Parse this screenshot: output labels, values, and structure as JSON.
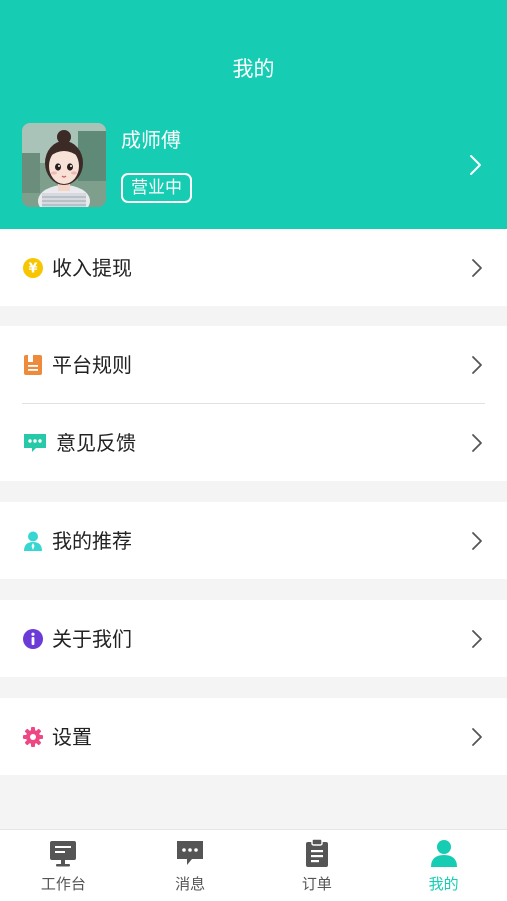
{
  "header": {
    "title": "我的"
  },
  "profile": {
    "name": "成师傅",
    "status": "营业中"
  },
  "menu": {
    "income": "收入提现",
    "rules": "平台规则",
    "feedback": "意见反馈",
    "recommend": "我的推荐",
    "about": "关于我们",
    "settings": "设置"
  },
  "tabs": [
    {
      "label": "工作台",
      "icon": "monitor-icon"
    },
    {
      "label": "消息",
      "icon": "message-icon"
    },
    {
      "label": "订单",
      "icon": "clipboard-icon"
    },
    {
      "label": "我的",
      "icon": "user-icon",
      "active": true
    }
  ],
  "colors": {
    "accent": "#16cdb3",
    "income": "#f7c600",
    "rules": "#ee8a3c",
    "feedback": "#27c9a8",
    "recommend": "#38d6d2",
    "about": "#6a3bd6",
    "settings": "#ee4784"
  }
}
